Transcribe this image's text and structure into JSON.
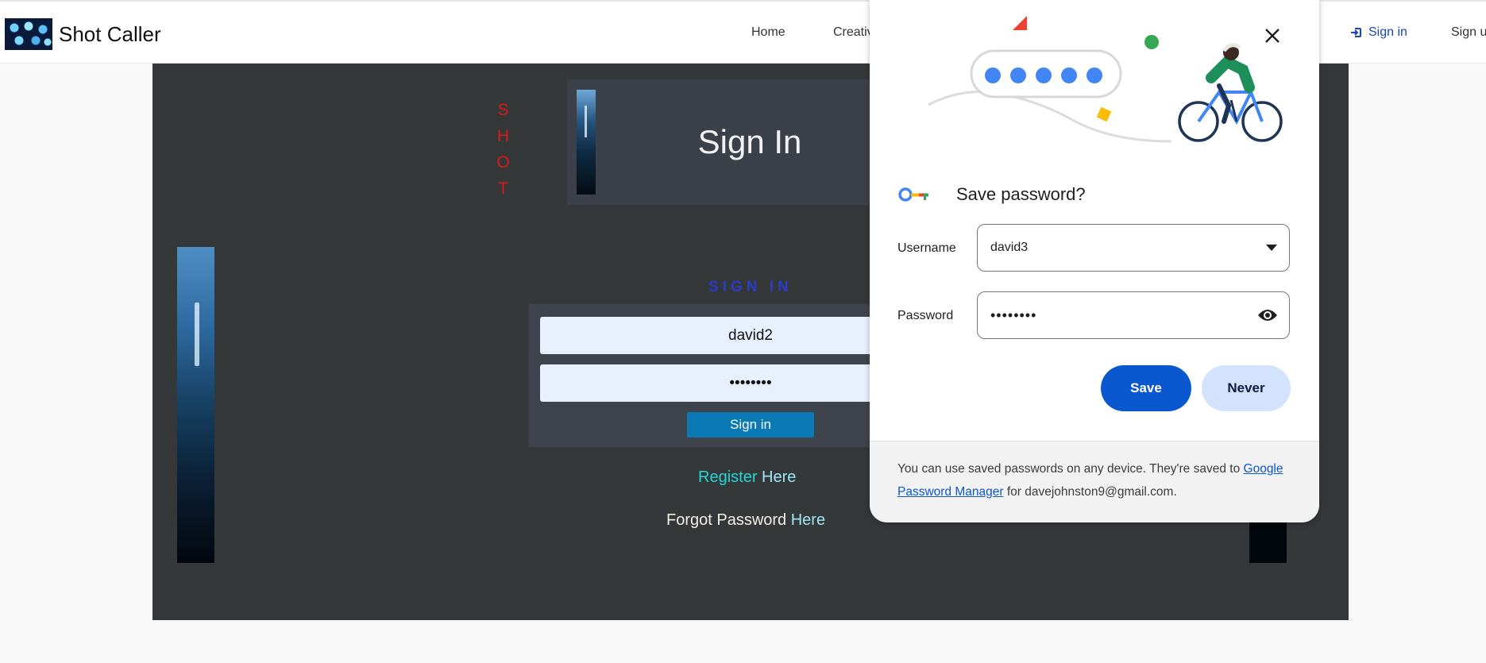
{
  "navbar": {
    "brand": "Shot Caller",
    "links": {
      "home": "Home",
      "creative": "Creative",
      "signin": "Sign in",
      "signup": "Sign up"
    }
  },
  "page": {
    "shot_letters": [
      "S",
      "H",
      "O",
      "T"
    ],
    "header_title": "Sign In",
    "subtitle": "SIGN IN",
    "username_value": "david2",
    "password_value": "••••••••",
    "signin_button": "Sign in",
    "register_word": "Register",
    "register_here": "Here",
    "forgot_text": "Forgot Password",
    "forgot_here": "Here"
  },
  "password_dialog": {
    "title": "Save password?",
    "username_label": "Username",
    "username_value": "david3",
    "password_label": "Password",
    "password_value": "••••••••",
    "save_button": "Save",
    "never_button": "Never",
    "footer_text": "You can use saved passwords on any device. They're saved to",
    "footer_link": "Google Password Manager",
    "footer_suffix": "for davejohnston9@gmail.com."
  },
  "icons": {
    "brand_logo": "shot-caller-logo",
    "signin": "sign-in-icon",
    "close": "close-icon",
    "key": "google-key-icon",
    "dropdown": "dropdown-arrow-icon",
    "reveal": "eye-icon"
  },
  "colors": {
    "main_bg": "#353839",
    "shot_letters": "#e01818",
    "subtitle": "#2a3cc8",
    "signin_button": "#0a79b4",
    "register_word": "#26d6d6",
    "here_links": "#9ee6f5",
    "forgot_text": "#f3f0e3",
    "nav_signin": "#1a46b8",
    "dialog_save": "#0b57d0",
    "dialog_never": "#d3e3fd"
  }
}
